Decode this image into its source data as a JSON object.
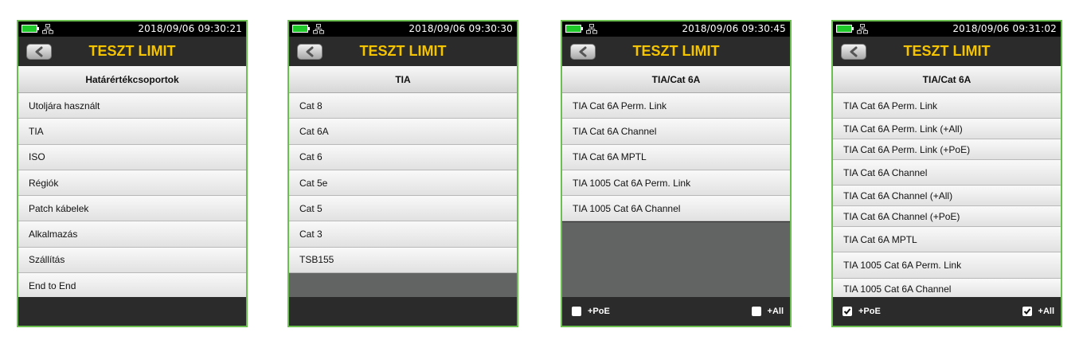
{
  "screens": [
    {
      "datetime": "2018/09/06  09:30:21",
      "title": "TESZT LIMIT",
      "group": "Határértékcsoportok",
      "items": [
        "Utoljára használt",
        "TIA",
        "ISO",
        "Régiók",
        "Patch kábelek",
        "Alkalmazás",
        "Szállítás",
        "End to End"
      ]
    },
    {
      "datetime": "2018/09/06  09:30:30",
      "title": "TESZT LIMIT",
      "group": "TIA",
      "items": [
        "Cat 8",
        "Cat 6A",
        "Cat 6",
        "Cat 5e",
        "Cat 5",
        "Cat 3",
        "TSB155"
      ]
    },
    {
      "datetime": "2018/09/06  09:30:45",
      "title": "TESZT LIMIT",
      "group": "TIA/Cat 6A",
      "items": [
        "TIA Cat 6A Perm. Link",
        "TIA Cat 6A Channel",
        "TIA Cat 6A MPTL",
        "TIA 1005 Cat 6A Perm. Link",
        "TIA 1005 Cat 6A Channel"
      ],
      "options": [
        {
          "label": "+PoE",
          "checked": false
        },
        {
          "label": "+All",
          "checked": false
        }
      ]
    },
    {
      "datetime": "2018/09/06  09:31:02",
      "title": "TESZT LIMIT",
      "group": "TIA/Cat 6A",
      "items": [
        "TIA Cat 6A Perm. Link",
        "TIA Cat 6A Perm. Link (+All)",
        "TIA Cat 6A Perm. Link (+PoE)",
        "TIA Cat 6A Channel",
        "TIA Cat 6A Channel (+All)",
        "TIA Cat 6A Channel (+PoE)",
        "TIA Cat 6A MPTL",
        "TIA 1005 Cat 6A Perm. Link",
        "TIA 1005 Cat 6A Channel"
      ],
      "options": [
        {
          "label": "+PoE",
          "checked": true
        },
        {
          "label": "+All",
          "checked": true
        }
      ]
    }
  ],
  "icons": {
    "battery": "battery-full-icon",
    "network": "network-icon",
    "back": "back-arrow-icon",
    "checkbox": "checkbox-icon"
  },
  "colors": {
    "frame": "#6bbf4e",
    "title": "#f5c400",
    "battery": "#1fc92a"
  }
}
